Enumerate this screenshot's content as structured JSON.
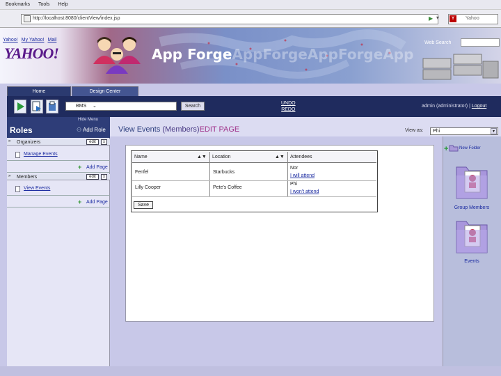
{
  "browser": {
    "menu": [
      "Bookmarks",
      "Tools",
      "Help"
    ],
    "url": "http://localhost:8080/clientView/index.jsp",
    "search_placeholder": "Yahoo"
  },
  "banner": {
    "links": [
      "Yahoo!",
      "My Yahoo!",
      "Mail"
    ],
    "logo": "YAHOO!",
    "app_title": "App Forge",
    "app_title_ghost": "AppForgeAppForgeApp",
    "web_search_label": "Web Search"
  },
  "tabs": [
    {
      "label": "Home"
    },
    {
      "label": "Design Center"
    }
  ],
  "toolbar": {
    "select_value": "BMS",
    "search_button": "Search",
    "undo": "UNDO",
    "redo": "REDO",
    "user": "admin (administrator) |",
    "logout": "Logout"
  },
  "sidebar": {
    "hide_menu": "Hide Menu",
    "title": "Roles",
    "add_role": "Add Role",
    "sections": [
      {
        "name": "Organizers",
        "edit": "edit",
        "close": "x",
        "item": "Manage Events",
        "add_page": "Add Page"
      },
      {
        "name": "Members",
        "edit": "edit",
        "close": "x",
        "item": "View Events",
        "add_page": "Add Page"
      }
    ]
  },
  "main": {
    "title_main": "View Events",
    "title_paren": "(Members)",
    "title_edit": "EDIT PAGE",
    "view_as_label": "View as:",
    "view_as_value": "Phi",
    "table": {
      "headers": [
        "Name",
        "Location",
        "Attendees"
      ],
      "sort_glyph": "▲▼",
      "rows": [
        {
          "name": "Fenfel",
          "location": "Starbucks",
          "attendees": [
            "Nor",
            "I will attend"
          ]
        },
        {
          "name": "Lilly Cooper",
          "location": "Pete's Coffee",
          "attendees": [
            "Phi",
            "I won't attend"
          ]
        }
      ],
      "save_button": "Save"
    }
  },
  "right_pane": {
    "new_folder": "New Folder",
    "folders": [
      {
        "label": "Group Members"
      },
      {
        "label": "Events"
      }
    ]
  }
}
